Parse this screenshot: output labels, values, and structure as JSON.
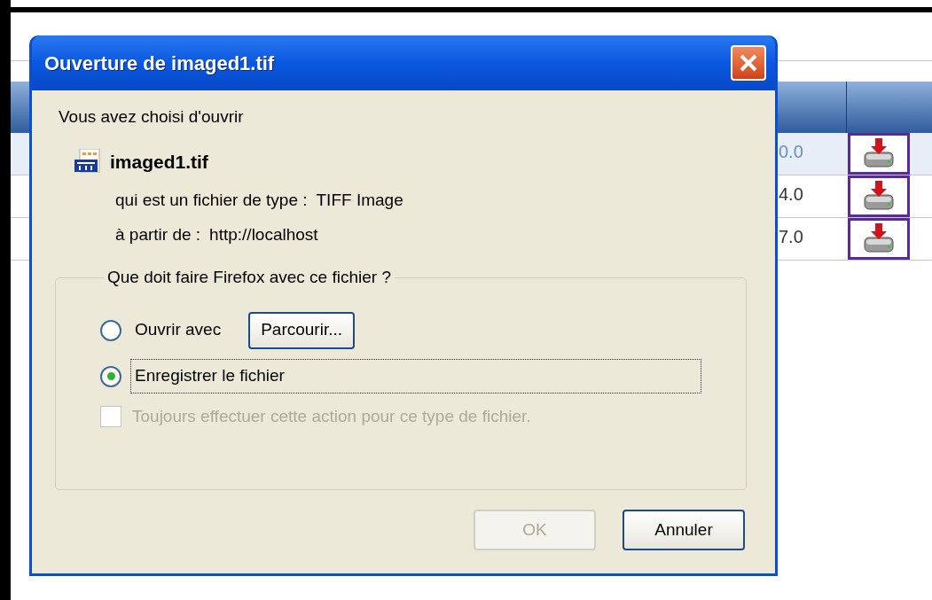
{
  "background_table": {
    "rows": [
      {
        "value": "0.0",
        "selected": true
      },
      {
        "value": "4.0",
        "selected": false
      },
      {
        "value": "7.0",
        "selected": false
      }
    ]
  },
  "dialog": {
    "title": "Ouverture de imaged1.tif",
    "intro": "Vous avez choisi d'ouvrir",
    "file_name": "imaged1.tif",
    "type_label": "qui est un fichier de type :",
    "type_value": "TIFF Image",
    "source_label": "à partir de :",
    "source_value": "http://localhost",
    "group_label": "Que doit faire Firefox avec ce fichier ?",
    "options": [
      {
        "kind": "radio",
        "label": "Ouvrir avec",
        "selected": false,
        "focused": false,
        "button": "Parcourir..."
      },
      {
        "kind": "radio",
        "label": "Enregistrer le fichier",
        "selected": true,
        "focused": true
      }
    ],
    "always": {
      "label": "Toujours effectuer cette action pour ce type de fichier.",
      "checked": false,
      "disabled": true
    },
    "buttons": [
      {
        "label": "OK",
        "disabled": true
      },
      {
        "label": "Annuler",
        "disabled": false
      }
    ]
  }
}
